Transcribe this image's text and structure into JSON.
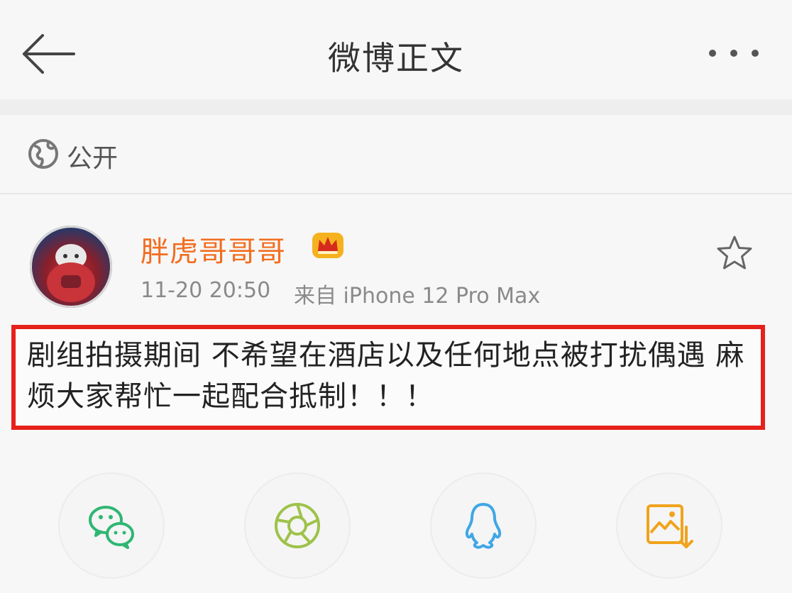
{
  "header": {
    "title": "微博正文",
    "back_icon": "arrow-left-icon",
    "more_icon": "more-horizontal-icon"
  },
  "visibility": {
    "icon": "globe-icon",
    "label": "公开"
  },
  "post": {
    "author": "胖虎哥哥哥",
    "vip_badge_icon": "crown-badge-icon",
    "timestamp": "11-20 20:50",
    "source": "来自 iPhone 12 Pro Max",
    "text": "剧组拍摄期间 不希望在酒店以及任何地点被打扰偶遇 麻烦大家帮忙一起配合抵制！！！",
    "favorite_icon": "star-icon",
    "highlight_color": "#e6211b",
    "author_color": "#f26d1f"
  },
  "share": {
    "wechat_icon": "wechat-icon",
    "moments_icon": "moments-aperture-icon",
    "qq_icon": "qq-penguin-icon",
    "save_image_icon": "save-image-icon"
  }
}
